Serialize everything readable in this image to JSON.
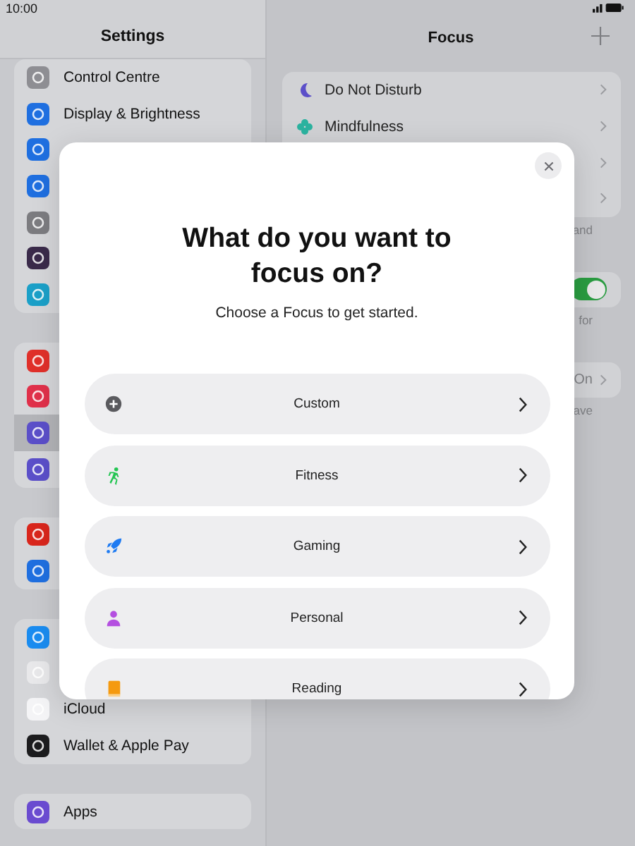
{
  "status_bar": {
    "time": "10:00"
  },
  "sidebar": {
    "title": "Settings",
    "groups": [
      {
        "items": [
          {
            "label": "Control Centre",
            "selected": false
          },
          {
            "label": "Display & Brightness",
            "selected": false
          },
          {
            "selected": false
          },
          {
            "selected": false
          },
          {
            "selected": false
          },
          {
            "selected": false
          },
          {
            "selected": false
          }
        ]
      },
      {
        "items": [
          {
            "selected": false
          },
          {
            "selected": false
          },
          {
            "selected": true
          },
          {
            "selected": false
          }
        ]
      },
      {
        "items": [
          {
            "selected": false
          },
          {
            "selected": false
          }
        ]
      },
      {
        "items": [
          {
            "selected": false
          },
          {
            "selected": false
          },
          {
            "label": "iCloud",
            "selected": false
          },
          {
            "label": "Wallet & Apple Pay",
            "selected": false
          }
        ]
      },
      {
        "items": [
          {
            "label": "Apps",
            "selected": false
          }
        ]
      }
    ]
  },
  "detail": {
    "title": "Focus",
    "sections": [
      {
        "kind": "list",
        "rows": [
          {
            "label": "Do Not Disturb"
          },
          {
            "label": "Mindfulness"
          },
          {},
          {}
        ]
      },
      {
        "kind": "note",
        "text": "and"
      },
      {
        "kind": "toggle",
        "on": true
      },
      {
        "kind": "note",
        "text": "for"
      },
      {
        "kind": "value",
        "value": "On"
      },
      {
        "kind": "note",
        "text": "ave"
      }
    ]
  },
  "modal": {
    "title": "What do you want to focus on?",
    "subtitle": "Choose a Focus to get started.",
    "options": [
      {
        "label": "Custom"
      },
      {
        "label": "Fitness"
      },
      {
        "label": "Gaming"
      },
      {
        "label": "Personal"
      },
      {
        "label": "Reading"
      }
    ]
  }
}
